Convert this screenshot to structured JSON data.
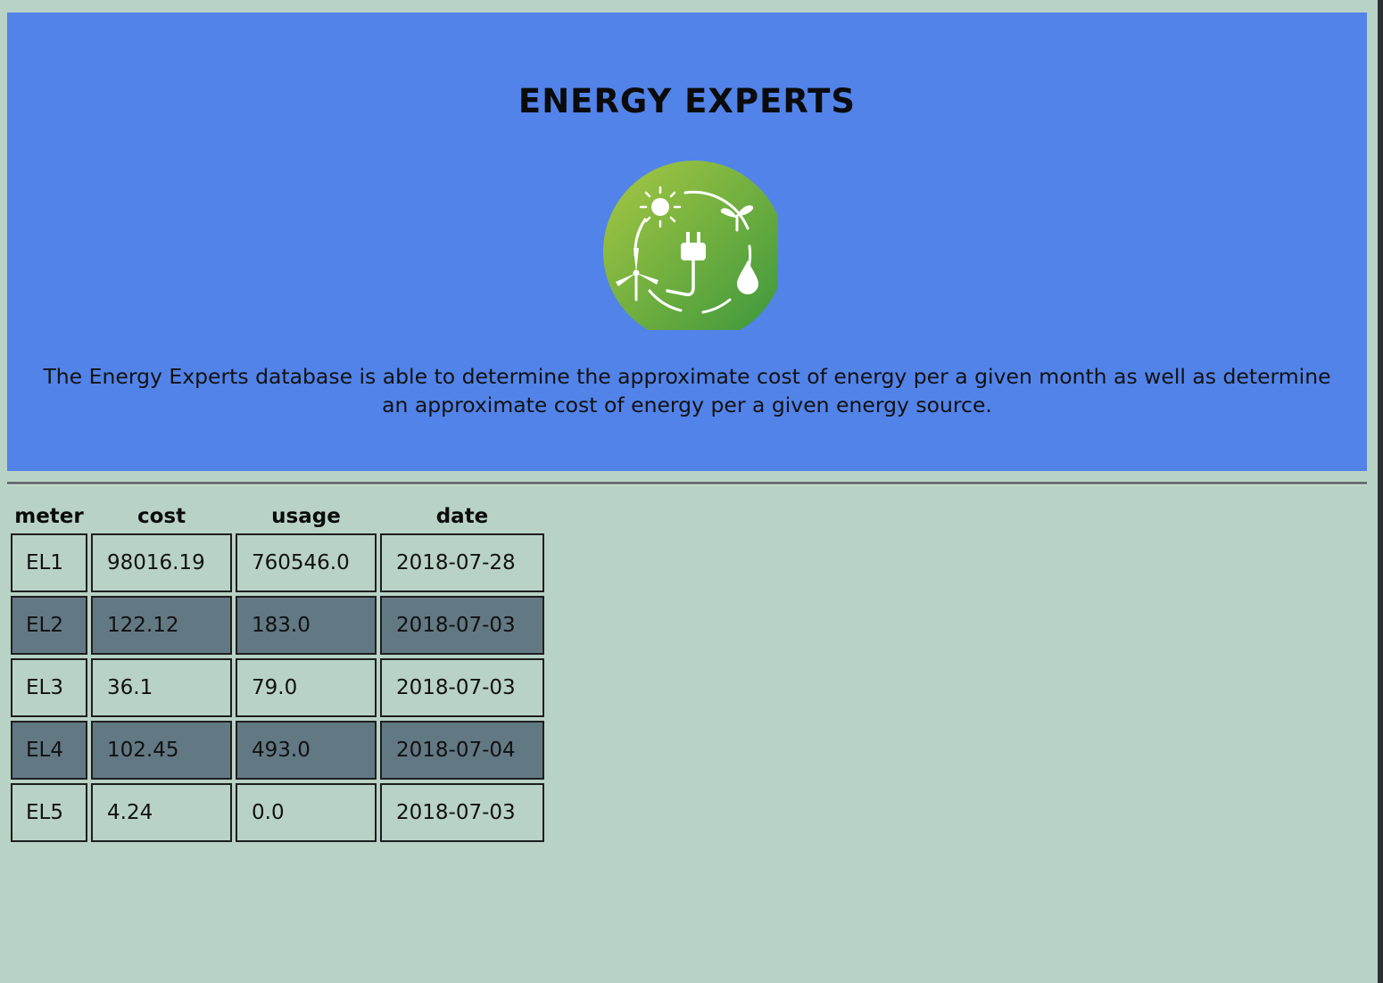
{
  "header": {
    "title": "ENERGY EXPERTS",
    "logo_icon": "renewable-energy-icon",
    "description": "The Energy Experts database is able to determine the approximate cost of energy per a given month as well as determine an approximate cost of energy per a given energy source."
  },
  "colors": {
    "header_background": "#5283e9",
    "page_background": "#b8d3c5",
    "row_alt_background": "#627984",
    "logo_gradient_start": "#a3c441",
    "logo_gradient_end": "#3a9a3e"
  },
  "table": {
    "columns": [
      "meter",
      "cost",
      "usage",
      "date"
    ],
    "rows": [
      {
        "meter": "EL1",
        "cost": "98016.19",
        "usage": "760546.0",
        "date": "2018-07-28"
      },
      {
        "meter": "EL2",
        "cost": "122.12",
        "usage": "183.0",
        "date": "2018-07-03"
      },
      {
        "meter": "EL3",
        "cost": "36.1",
        "usage": "79.0",
        "date": "2018-07-03"
      },
      {
        "meter": "EL4",
        "cost": "102.45",
        "usage": "493.0",
        "date": "2018-07-04"
      },
      {
        "meter": "EL5",
        "cost": "4.24",
        "usage": "0.0",
        "date": "2018-07-03"
      }
    ]
  }
}
